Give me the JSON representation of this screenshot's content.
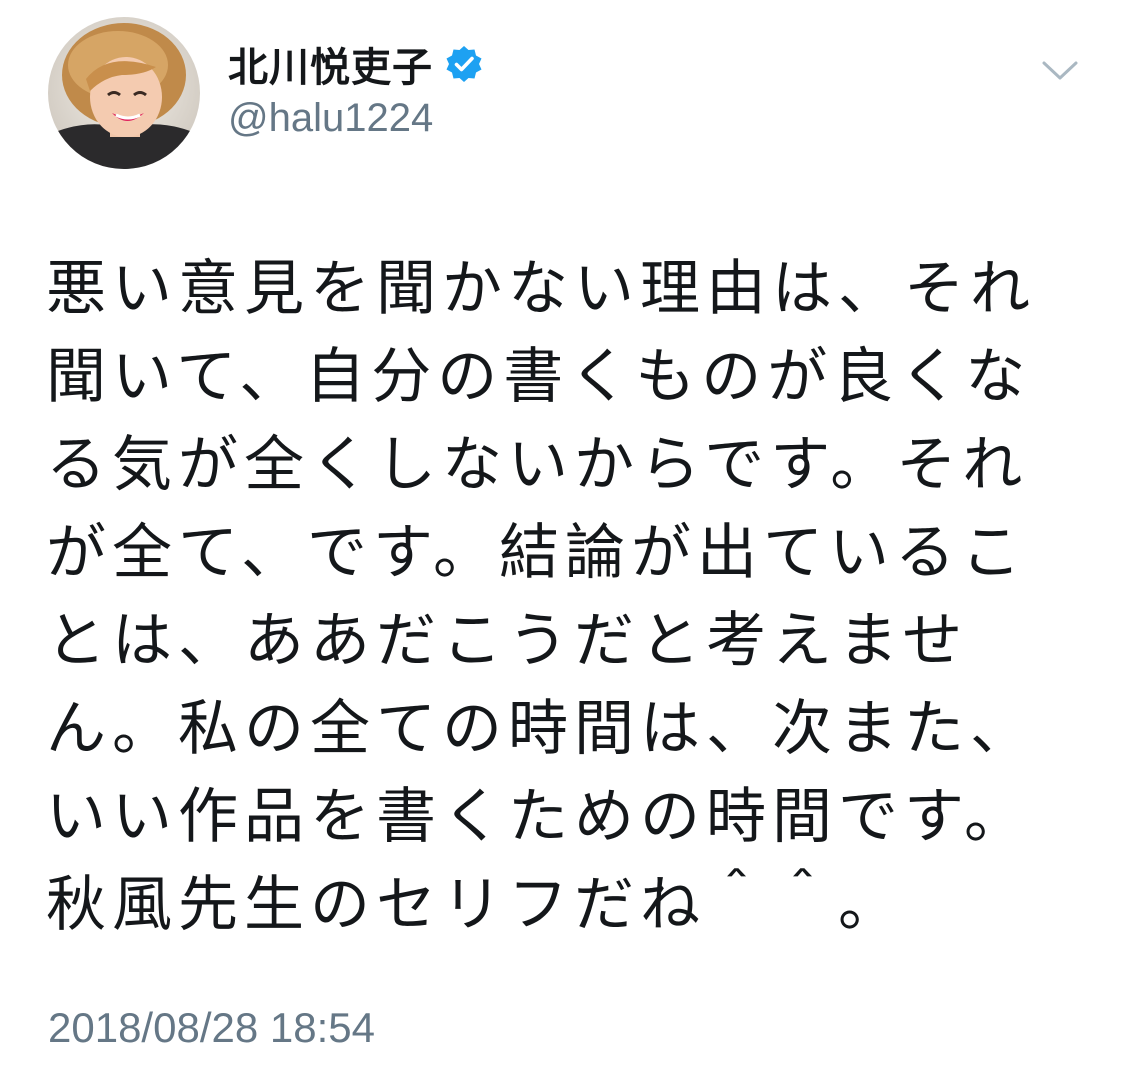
{
  "user": {
    "display_name": "北川悦吏子",
    "handle": "@halu1224",
    "verified": true,
    "avatar_icon": "profile-photo",
    "verified_icon": "verified-badge-icon"
  },
  "menu": {
    "caret_icon": "chevron-down-icon"
  },
  "tweet": {
    "lines": [
      "悪い意見を聞かない理由は、それ",
      "聞いて、自分の書くものが良くな",
      "る気が全くしないからです。それ",
      "が全て、です。結論が出ているこ",
      "とは、ああだこうだと考えませ",
      "ん。私の全ての時間は、次また、",
      "いい作品を書くための時間です。",
      "秋風先生のセリフだね＾＾。"
    ],
    "timestamp": "2018/08/28 18:54"
  },
  "colors": {
    "text": "#14171a",
    "secondary": "#657786",
    "verified_blue": "#1da1f2",
    "caret": "#aab8c2",
    "background": "#ffffff"
  }
}
